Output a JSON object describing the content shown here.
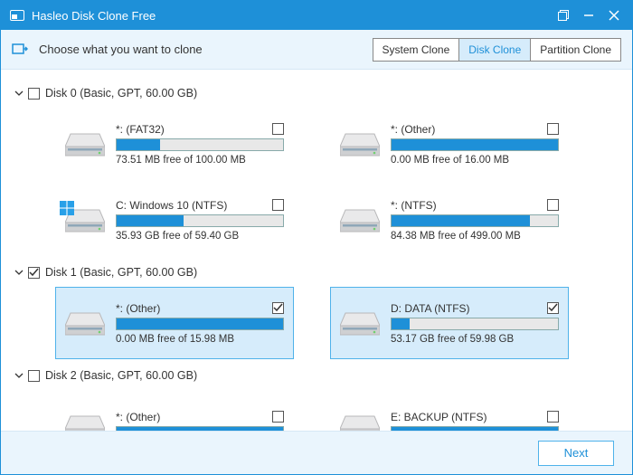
{
  "titlebar": {
    "title": "Hasleo Disk Clone Free"
  },
  "subheader": {
    "text": "Choose what you want to clone",
    "tabs": {
      "system": "System Clone",
      "disk": "Disk Clone",
      "partition": "Partition Clone"
    }
  },
  "disks": [
    {
      "label": "Disk 0 (Basic, GPT, 60.00 GB)",
      "checked": false,
      "expanded": true,
      "partitions": [
        {
          "name": "*: (FAT32)",
          "free": "73.51 MB free of 100.00 MB",
          "fillPct": 26,
          "checked": false,
          "winLogo": false
        },
        {
          "name": "*: (Other)",
          "free": "0.00 MB free of 16.00 MB",
          "fillPct": 100,
          "checked": false,
          "winLogo": false
        },
        {
          "name": "C: Windows 10 (NTFS)",
          "free": "35.93 GB free of 59.40 GB",
          "fillPct": 40,
          "checked": false,
          "winLogo": true
        },
        {
          "name": "*: (NTFS)",
          "free": "84.38 MB free of 499.00 MB",
          "fillPct": 83,
          "checked": false,
          "winLogo": false
        }
      ]
    },
    {
      "label": "Disk 1 (Basic, GPT, 60.00 GB)",
      "checked": true,
      "expanded": true,
      "partitions": [
        {
          "name": "*: (Other)",
          "free": "0.00 MB free of 15.98 MB",
          "fillPct": 100,
          "checked": true,
          "winLogo": false
        },
        {
          "name": "D: DATA (NTFS)",
          "free": "53.17 GB free of 59.98 GB",
          "fillPct": 11,
          "checked": true,
          "winLogo": false
        }
      ]
    },
    {
      "label": "Disk 2 (Basic, GPT, 60.00 GB)",
      "checked": false,
      "expanded": true,
      "partitions": [
        {
          "name": "*: (Other)",
          "free": "",
          "fillPct": 100,
          "checked": false,
          "winLogo": false
        },
        {
          "name": "E: BACKUP (NTFS)",
          "free": "",
          "fillPct": 100,
          "checked": false,
          "winLogo": false
        }
      ]
    }
  ],
  "footer": {
    "next": "Next"
  }
}
